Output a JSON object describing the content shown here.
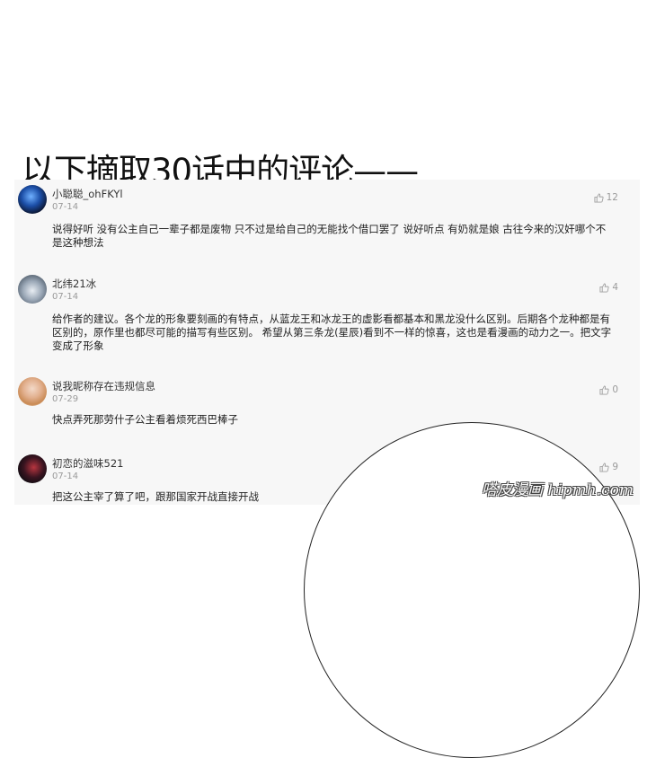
{
  "headline": "以下摘取30话中的评论——",
  "comments": [
    {
      "username": "小聪聪_ohFKYl",
      "date": "07-14",
      "likes": "12",
      "text": "说得好听 没有公主自己一辈子都是废物 只不过是给自己的无能找个借口罢了 说好听点 有奶就是娘 古往今来的汉奸哪个不是这种想法"
    },
    {
      "username": "北纬21冰",
      "date": "07-14",
      "likes": "4",
      "text": "给作者的建议。各个龙的形象要刻画的有特点，从蓝龙王和冰龙王的虚影看都基本和黑龙没什么区别。后期各个龙种都是有区别的，原作里也都尽可能的描写有些区别。 希望从第三条龙(星辰)看到不一样的惊喜，这也是看漫画的动力之一。把文字变成了形象"
    },
    {
      "username": "说我昵称存在违规信息",
      "date": "07-29",
      "likes": "0",
      "text": "快点弄死那劳什子公主看着烦死西巴棒子"
    },
    {
      "username": "初恋的滋味521",
      "date": "07-14",
      "likes": "9",
      "text": "把这公主宰了算了吧，跟那国家开战直接开战"
    }
  ],
  "watermark": "嗒皮漫画 hipmh.com",
  "icons": {
    "like": "thumbs-up-icon"
  },
  "colors": {
    "panel": "#f7f7f7",
    "muted": "#9a9a9a",
    "text": "#222222"
  }
}
